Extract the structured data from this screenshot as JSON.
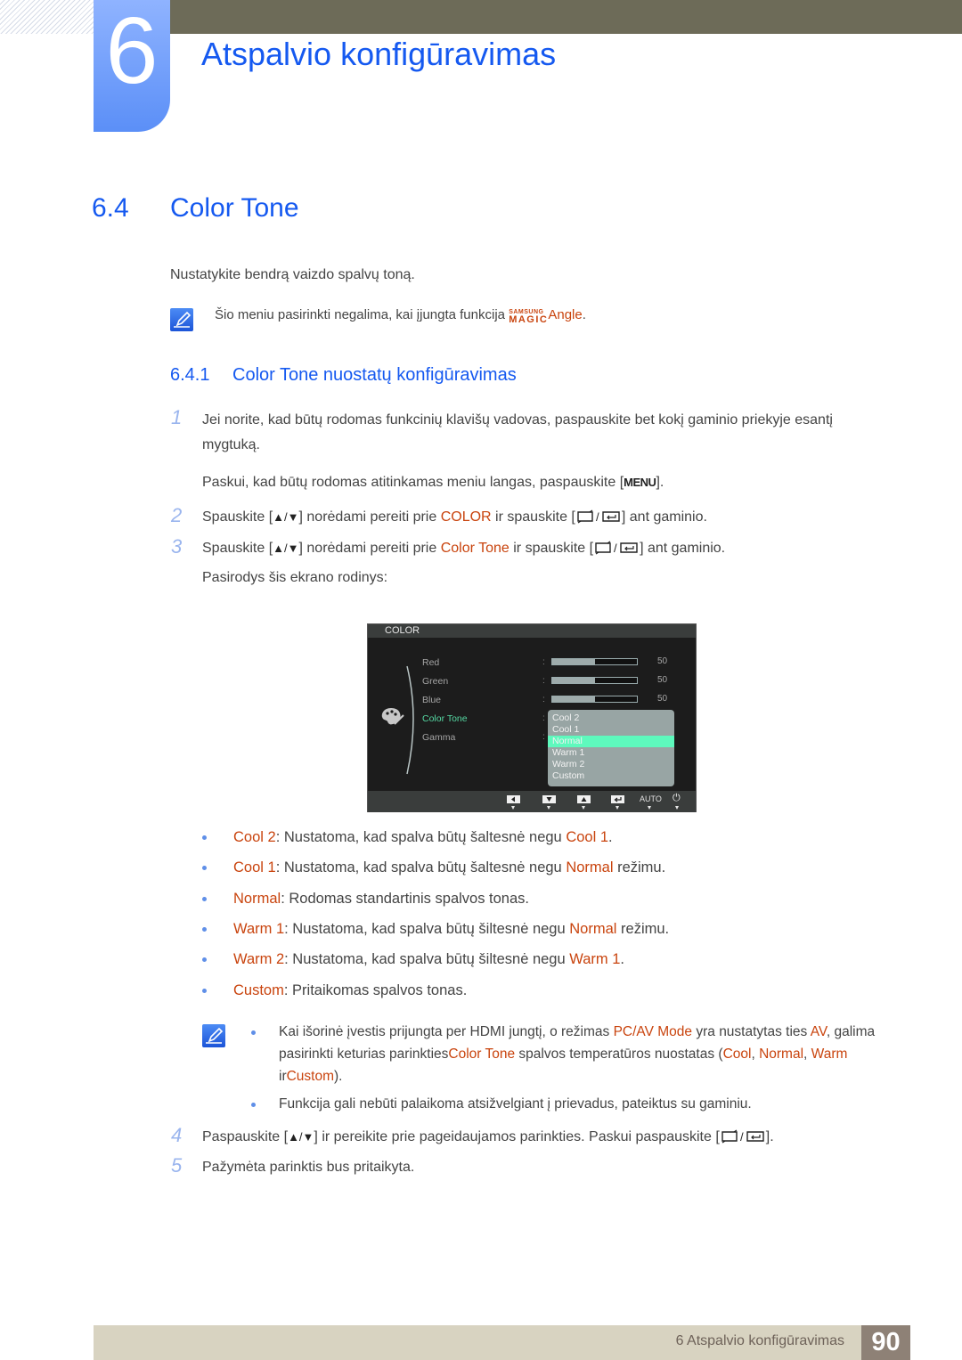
{
  "chapter": {
    "number": "6",
    "title": "Atspalvio konfigūravimas"
  },
  "section": {
    "number": "6.4",
    "title": "Color Tone"
  },
  "intro": "Nustatykite bendrą vaizdo spalvų toną.",
  "note1": {
    "text": "Šio meniu pasirinkti negalima, kai įjungta funkcija",
    "brand_top": "SAMSUNG",
    "brand_bottom": "MAGIC",
    "brand_word": "Angle",
    "end": "."
  },
  "subsection": {
    "number": "6.4.1",
    "title": "Color Tone nuostatų konfigūravimas"
  },
  "steps": {
    "s1": {
      "num": "1",
      "line1": "Jei norite, kad būtų rodomas funkcinių klavišų vadovas, paspauskite bet kokį gaminio priekyje esantį",
      "line2": "mygtuką.",
      "para_pre": "Paskui, kad būtų rodomas atitinkamas meniu langas, paspauskite [",
      "menu_key": "MENU",
      "para_post": "]."
    },
    "s2": {
      "num": "2",
      "pre": "Spauskite [",
      "keys": "▲/▼",
      "mid": "] norėdami pereiti prie ",
      "target": "COLOR",
      "mid2": " ir spauskite [",
      "post": "] ant gaminio."
    },
    "s3": {
      "num": "3",
      "pre": "Spauskite [",
      "keys": "▲/▼",
      "mid": "] norėdami pereiti prie ",
      "target": "Color Tone",
      "mid2": " ir spauskite [",
      "post": "] ant gaminio.",
      "after": "Pasirodys šis ekrano rodinys:"
    },
    "s4": {
      "num": "4",
      "pre": "Paspauskite [",
      "keys": "▲/▼",
      "mid": "] ir pereikite prie pageidaujamos parinkties. Paskui paspauskite [",
      "post": "]."
    },
    "s5": {
      "num": "5",
      "text": "Pažymėta parinktis bus pritaikyta."
    }
  },
  "osd": {
    "header": "COLOR",
    "menu_items": [
      "Red",
      "Green",
      "Blue",
      "Color Tone",
      "Gamma"
    ],
    "active_item": "Color Tone",
    "sliders": [
      {
        "label": "Red",
        "value": "50",
        "fraction": 0.5
      },
      {
        "label": "Green",
        "value": "50",
        "fraction": 0.5
      },
      {
        "label": "Blue",
        "value": "50",
        "fraction": 0.5
      }
    ],
    "dropdown_options": [
      "Cool 2",
      "Cool 1",
      "Normal",
      "Warm 1",
      "Warm 2",
      "Custom"
    ],
    "selected_option": "Normal",
    "footer": {
      "buttons": [
        "left-arrow-icon",
        "down-arrow-icon",
        "up-arrow-icon",
        "enter-icon"
      ],
      "auto_label": "AUTO",
      "power_glyph": "⏻"
    }
  },
  "options_list": [
    {
      "term": "Cool 2",
      "text": ": Nustatoma, kad spalva būtų šaltesnė negu ",
      "ref": "Cool 1",
      "tail": "."
    },
    {
      "term": "Cool 1",
      "text": ": Nustatoma, kad spalva būtų šaltesnė negu ",
      "ref": "Normal",
      "tail": " režimu."
    },
    {
      "term": "Normal",
      "text": ": Rodomas standartinis spalvos tonas.",
      "ref": "",
      "tail": ""
    },
    {
      "term": "Warm 1",
      "text": ": Nustatoma, kad spalva būtų šiltesnė negu ",
      "ref": "Normal",
      "tail": " režimu."
    },
    {
      "term": "Warm 2",
      "text": ": Nustatoma, kad spalva būtų šiltesnė negu ",
      "ref": "Warm 1",
      "tail": "."
    },
    {
      "term": "Custom",
      "text": ": Pritaikomas spalvos tonas.",
      "ref": "",
      "tail": ""
    }
  ],
  "note2": {
    "b1": {
      "t1": "Kai išorinė įvestis prijungta per HDMI jungtį, o režimas ",
      "h1": "PC/AV Mode",
      "t2": " yra nustatytas ties ",
      "h2": "AV",
      "t3": ", galima pasirinkti keturias parinkties",
      "h3": "Color Tone",
      "t4": " spalvos temperatūros nuostatas (",
      "h4": "Cool",
      "t5": ", ",
      "h5": "Normal",
      "t6": ", ",
      "h6": "Warm",
      "t7": " ir",
      "h7": "Custom",
      "t8": ")."
    },
    "b2": "Funkcija gali nebūti palaikoma atsižvelgiant į prievadus, pateiktus su gaminiu."
  },
  "footer": {
    "chapter_label": "6 Atspalvio konfigūravimas",
    "page": "90"
  },
  "colors": {
    "heading_blue": "#1559f0",
    "highlight_orange": "#c9440e",
    "osd_active_green": "#55d9a3",
    "osd_selected_bg": "#5ef9bd"
  }
}
